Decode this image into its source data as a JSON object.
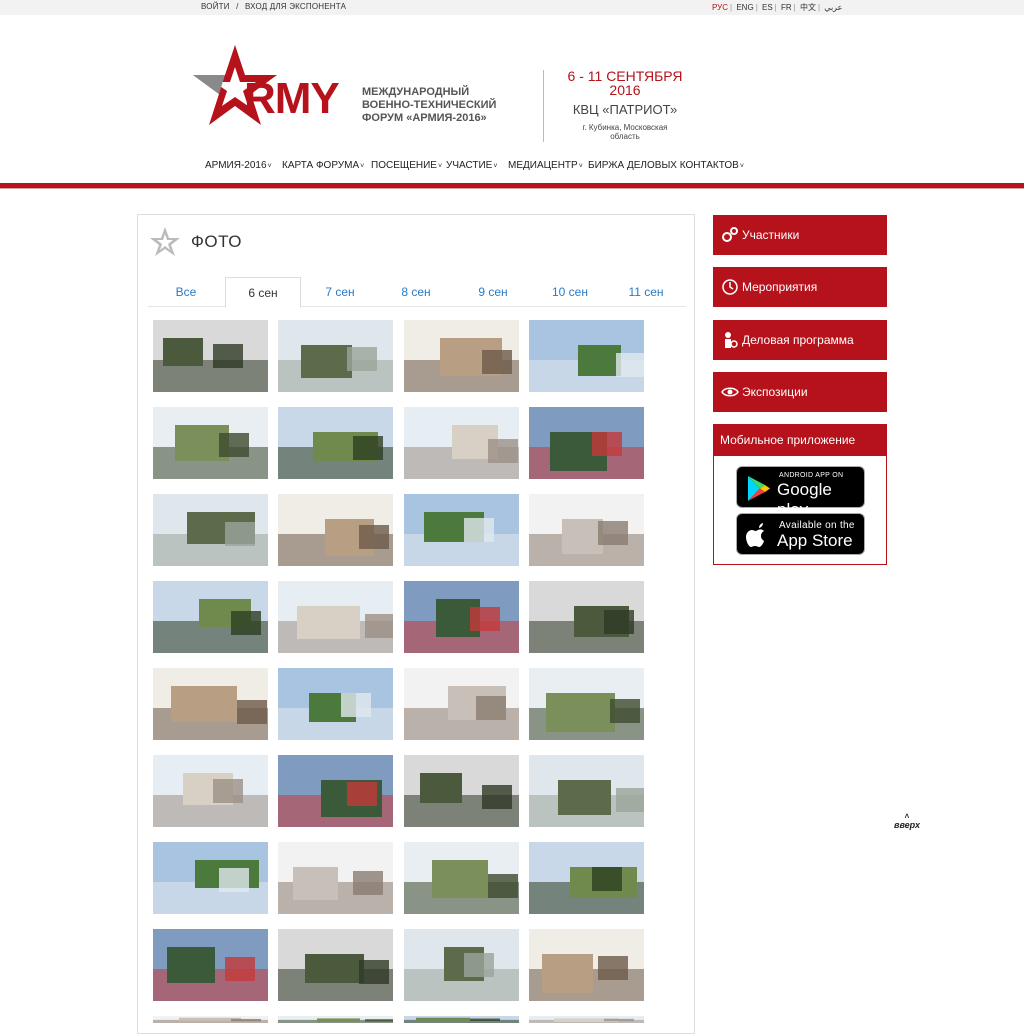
{
  "topbar": {
    "login": "ВОЙТИ",
    "divider": "/",
    "exhibitor_login": "ВХОД ДЛЯ ЭКСПОНЕНТА",
    "languages": [
      "РУС",
      "ENG",
      "ES",
      "FR",
      "中文",
      "عربي"
    ]
  },
  "header": {
    "logo_word": "RMY",
    "logo_subtitle": "МЕЖДУНАРОДНЫЙ ВОЕННО-ТЕХНИЧЕСКИЙ ФОРУМ «АРМИЯ-2016»",
    "dates": "6 - 11 СЕНТЯБРЯ 2016",
    "venue": "КВЦ «ПАТРИОТ»",
    "city": "г. Кубинка, Московская область"
  },
  "nav": {
    "items": [
      "АРМИЯ-2016",
      "КАРТА ФОРУМА",
      "ПОСЕЩЕНИЕ",
      "УЧАСТИЕ",
      "МЕДИАЦЕНТР",
      "БИРЖА ДЕЛОВЫХ КОНТАКТОВ"
    ]
  },
  "gallery": {
    "title": "ФОТО",
    "tabs": [
      "Все",
      "6 сен",
      "7 сен",
      "8 сен",
      "9 сен",
      "10 сен",
      "11 сен"
    ],
    "active_tab": "6 сен"
  },
  "sidebar": {
    "buttons": [
      "Участники",
      "Мероприятия",
      "Деловая программа",
      "Экспозиции"
    ],
    "mobile_title": "Мобильное приложение",
    "google_small": "ANDROID APP ON",
    "google_big": "Google play",
    "apple_small": "Available on the",
    "apple_big": "App Store"
  },
  "scroll_up": "вверх",
  "colors": {
    "brand_red": "#b5121b",
    "link_blue": "#2a7bc4"
  }
}
